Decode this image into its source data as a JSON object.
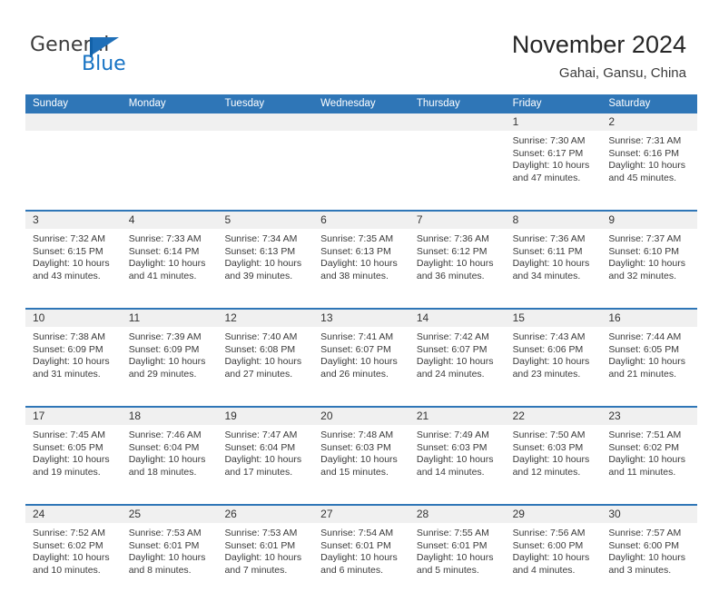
{
  "logo": {
    "word_one": "General",
    "word_two": "Blue",
    "flag_icon": "triangle-flag-icon",
    "brand_blue": "#1773c4",
    "brand_dark": "#3c3c3c"
  },
  "header": {
    "title": "November 2024",
    "subtitle": "Gahai, Gansu, China"
  },
  "colors": {
    "header_blue": "#2f76b7",
    "daynum_band": "#f0f0f0",
    "text": "#3a3a3a"
  },
  "calendar": {
    "weekdays": [
      "Sunday",
      "Monday",
      "Tuesday",
      "Wednesday",
      "Thursday",
      "Friday",
      "Saturday"
    ],
    "weeks": [
      [
        {
          "day": "",
          "lines": []
        },
        {
          "day": "",
          "lines": []
        },
        {
          "day": "",
          "lines": []
        },
        {
          "day": "",
          "lines": []
        },
        {
          "day": "",
          "lines": []
        },
        {
          "day": "1",
          "lines": [
            "Sunrise: 7:30 AM",
            "Sunset: 6:17 PM",
            "Daylight: 10 hours",
            "and 47 minutes."
          ]
        },
        {
          "day": "2",
          "lines": [
            "Sunrise: 7:31 AM",
            "Sunset: 6:16 PM",
            "Daylight: 10 hours",
            "and 45 minutes."
          ]
        }
      ],
      [
        {
          "day": "3",
          "lines": [
            "Sunrise: 7:32 AM",
            "Sunset: 6:15 PM",
            "Daylight: 10 hours",
            "and 43 minutes."
          ]
        },
        {
          "day": "4",
          "lines": [
            "Sunrise: 7:33 AM",
            "Sunset: 6:14 PM",
            "Daylight: 10 hours",
            "and 41 minutes."
          ]
        },
        {
          "day": "5",
          "lines": [
            "Sunrise: 7:34 AM",
            "Sunset: 6:13 PM",
            "Daylight: 10 hours",
            "and 39 minutes."
          ]
        },
        {
          "day": "6",
          "lines": [
            "Sunrise: 7:35 AM",
            "Sunset: 6:13 PM",
            "Daylight: 10 hours",
            "and 38 minutes."
          ]
        },
        {
          "day": "7",
          "lines": [
            "Sunrise: 7:36 AM",
            "Sunset: 6:12 PM",
            "Daylight: 10 hours",
            "and 36 minutes."
          ]
        },
        {
          "day": "8",
          "lines": [
            "Sunrise: 7:36 AM",
            "Sunset: 6:11 PM",
            "Daylight: 10 hours",
            "and 34 minutes."
          ]
        },
        {
          "day": "9",
          "lines": [
            "Sunrise: 7:37 AM",
            "Sunset: 6:10 PM",
            "Daylight: 10 hours",
            "and 32 minutes."
          ]
        }
      ],
      [
        {
          "day": "10",
          "lines": [
            "Sunrise: 7:38 AM",
            "Sunset: 6:09 PM",
            "Daylight: 10 hours",
            "and 31 minutes."
          ]
        },
        {
          "day": "11",
          "lines": [
            "Sunrise: 7:39 AM",
            "Sunset: 6:09 PM",
            "Daylight: 10 hours",
            "and 29 minutes."
          ]
        },
        {
          "day": "12",
          "lines": [
            "Sunrise: 7:40 AM",
            "Sunset: 6:08 PM",
            "Daylight: 10 hours",
            "and 27 minutes."
          ]
        },
        {
          "day": "13",
          "lines": [
            "Sunrise: 7:41 AM",
            "Sunset: 6:07 PM",
            "Daylight: 10 hours",
            "and 26 minutes."
          ]
        },
        {
          "day": "14",
          "lines": [
            "Sunrise: 7:42 AM",
            "Sunset: 6:07 PM",
            "Daylight: 10 hours",
            "and 24 minutes."
          ]
        },
        {
          "day": "15",
          "lines": [
            "Sunrise: 7:43 AM",
            "Sunset: 6:06 PM",
            "Daylight: 10 hours",
            "and 23 minutes."
          ]
        },
        {
          "day": "16",
          "lines": [
            "Sunrise: 7:44 AM",
            "Sunset: 6:05 PM",
            "Daylight: 10 hours",
            "and 21 minutes."
          ]
        }
      ],
      [
        {
          "day": "17",
          "lines": [
            "Sunrise: 7:45 AM",
            "Sunset: 6:05 PM",
            "Daylight: 10 hours",
            "and 19 minutes."
          ]
        },
        {
          "day": "18",
          "lines": [
            "Sunrise: 7:46 AM",
            "Sunset: 6:04 PM",
            "Daylight: 10 hours",
            "and 18 minutes."
          ]
        },
        {
          "day": "19",
          "lines": [
            "Sunrise: 7:47 AM",
            "Sunset: 6:04 PM",
            "Daylight: 10 hours",
            "and 17 minutes."
          ]
        },
        {
          "day": "20",
          "lines": [
            "Sunrise: 7:48 AM",
            "Sunset: 6:03 PM",
            "Daylight: 10 hours",
            "and 15 minutes."
          ]
        },
        {
          "day": "21",
          "lines": [
            "Sunrise: 7:49 AM",
            "Sunset: 6:03 PM",
            "Daylight: 10 hours",
            "and 14 minutes."
          ]
        },
        {
          "day": "22",
          "lines": [
            "Sunrise: 7:50 AM",
            "Sunset: 6:03 PM",
            "Daylight: 10 hours",
            "and 12 minutes."
          ]
        },
        {
          "day": "23",
          "lines": [
            "Sunrise: 7:51 AM",
            "Sunset: 6:02 PM",
            "Daylight: 10 hours",
            "and 11 minutes."
          ]
        }
      ],
      [
        {
          "day": "24",
          "lines": [
            "Sunrise: 7:52 AM",
            "Sunset: 6:02 PM",
            "Daylight: 10 hours",
            "and 10 minutes."
          ]
        },
        {
          "day": "25",
          "lines": [
            "Sunrise: 7:53 AM",
            "Sunset: 6:01 PM",
            "Daylight: 10 hours",
            "and 8 minutes."
          ]
        },
        {
          "day": "26",
          "lines": [
            "Sunrise: 7:53 AM",
            "Sunset: 6:01 PM",
            "Daylight: 10 hours",
            "and 7 minutes."
          ]
        },
        {
          "day": "27",
          "lines": [
            "Sunrise: 7:54 AM",
            "Sunset: 6:01 PM",
            "Daylight: 10 hours",
            "and 6 minutes."
          ]
        },
        {
          "day": "28",
          "lines": [
            "Sunrise: 7:55 AM",
            "Sunset: 6:01 PM",
            "Daylight: 10 hours",
            "and 5 minutes."
          ]
        },
        {
          "day": "29",
          "lines": [
            "Sunrise: 7:56 AM",
            "Sunset: 6:00 PM",
            "Daylight: 10 hours",
            "and 4 minutes."
          ]
        },
        {
          "day": "30",
          "lines": [
            "Sunrise: 7:57 AM",
            "Sunset: 6:00 PM",
            "Daylight: 10 hours",
            "and 3 minutes."
          ]
        }
      ]
    ]
  }
}
